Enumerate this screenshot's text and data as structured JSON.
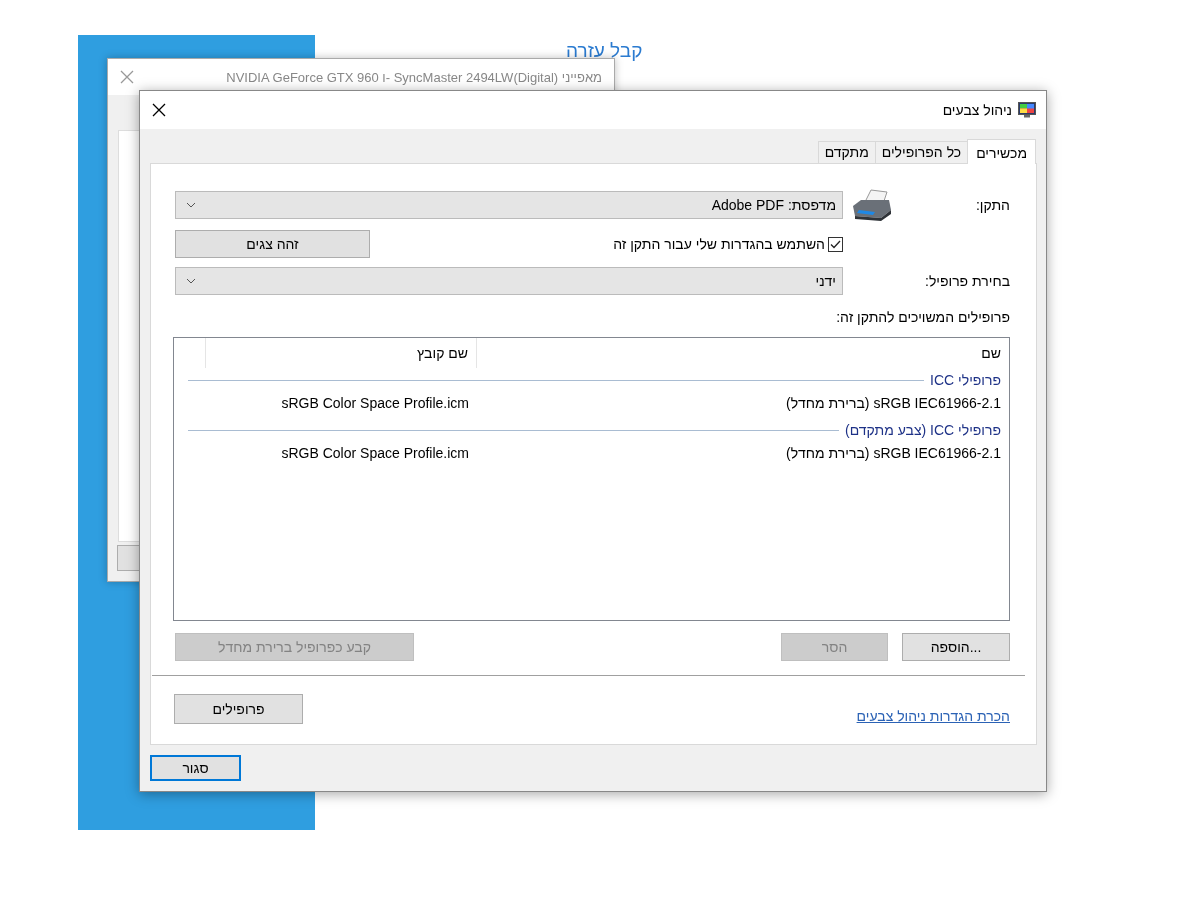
{
  "help_link": "קבל עזרה",
  "back_window": {
    "title": "מאפייני SyncMaster 2494LW(Digital) -ו NVIDIA GeForce GTX 960"
  },
  "dialog": {
    "title": "ניהול צבעים",
    "tabs": [
      {
        "label": "מכשירים",
        "selected": true
      },
      {
        "label": "כל הפרופילים",
        "selected": false
      },
      {
        "label": "מתקדם",
        "selected": false
      }
    ],
    "device": {
      "label": "התקן:",
      "value": "מדפסת: Adobe PDF"
    },
    "use_my_settings": {
      "label": "השתמש בהגדרות שלי עבור התקן זה",
      "checked": true
    },
    "identify_button": "זהה צגים",
    "profile_selection": {
      "label": "בחירת פרופיל:",
      "value": "ידני"
    },
    "profiles_label": "פרופילים המשויכים להתקן זה:",
    "columns": [
      "שם",
      "שם קובץ"
    ],
    "groups": [
      {
        "title": "פרופילי ICC",
        "rows": [
          {
            "name": "sRGB IEC61966-2.1 (ברירת מחדל)",
            "file": "sRGB Color Space Profile.icm"
          }
        ]
      },
      {
        "title": "פרופילי ICC (צבע מתקדם)",
        "rows": [
          {
            "name": "sRGB IEC61966-2.1 (ברירת מחדל)",
            "file": "sRGB Color Space Profile.icm"
          }
        ]
      }
    ],
    "list_buttons": [
      {
        "label": "הוספה...",
        "disabled": false
      },
      {
        "label": "הסר",
        "disabled": true
      },
      {
        "label": "קבע כפרופיל ברירת מחדל",
        "disabled": true
      }
    ],
    "learn_link": "הכרת הגדרות ניהול צבעים",
    "profiles_button": "פרופילים",
    "close_button": "סגור"
  }
}
